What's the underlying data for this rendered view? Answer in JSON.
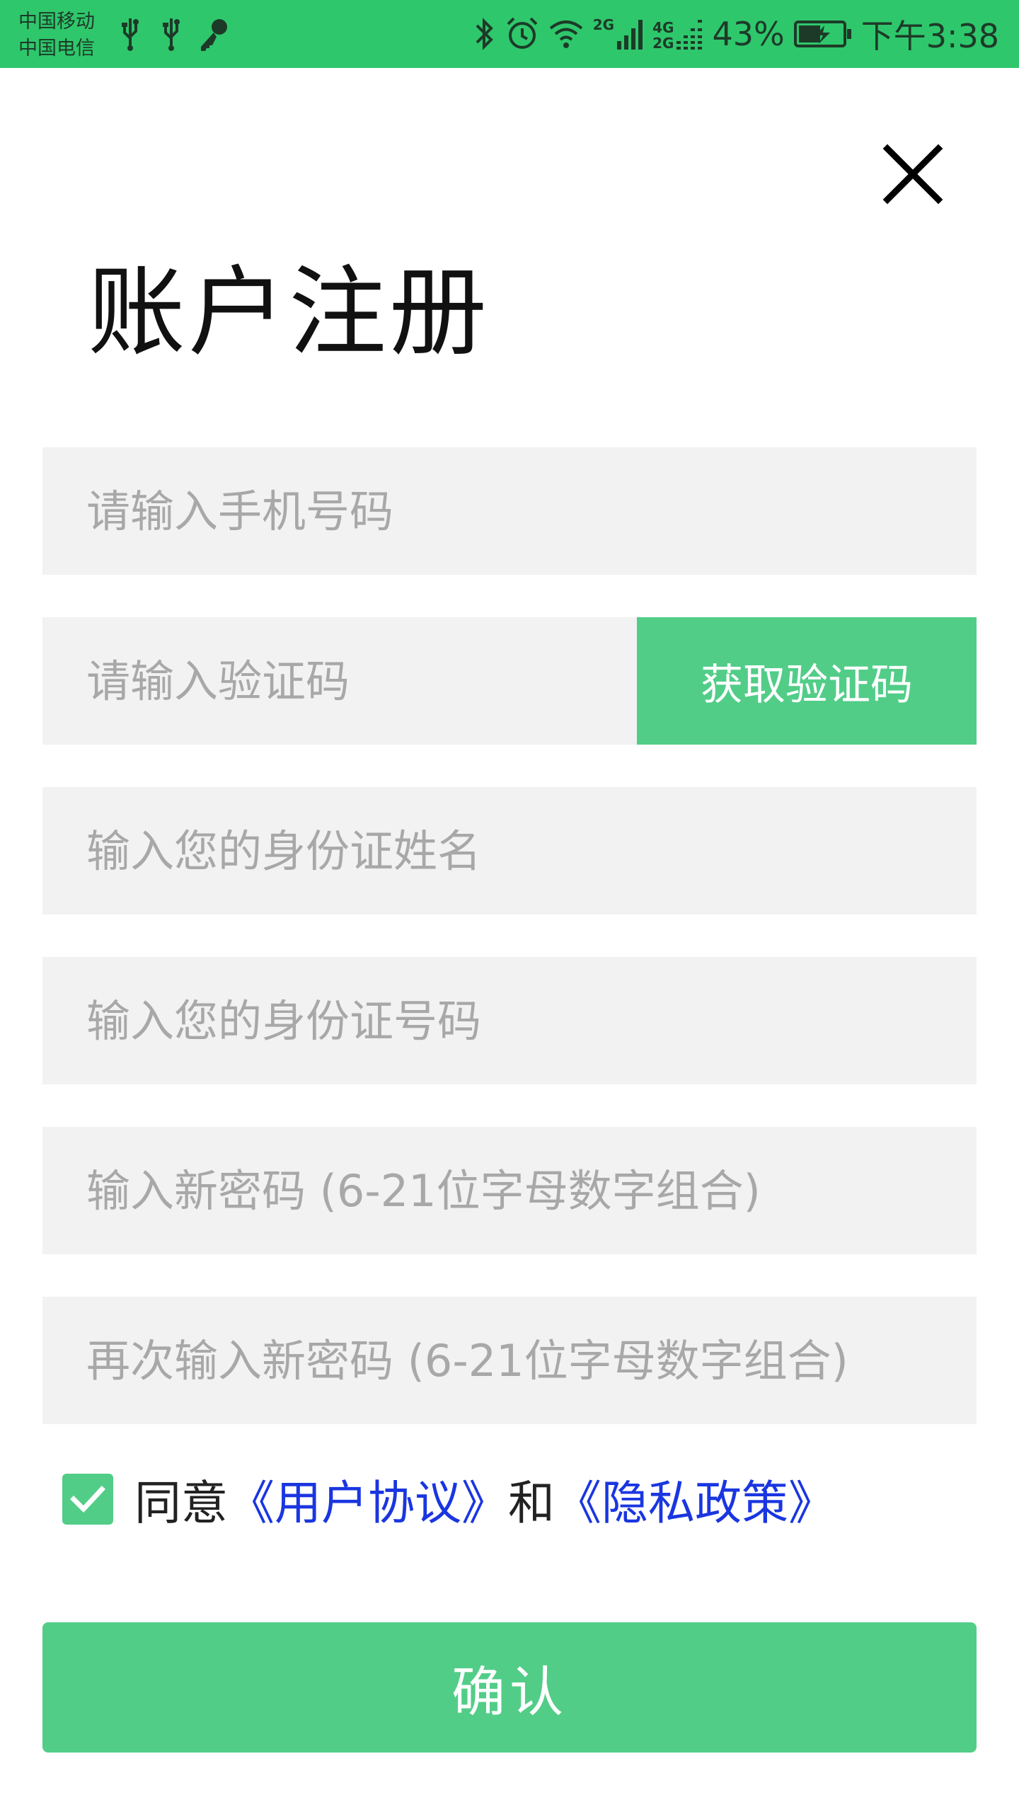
{
  "status_bar": {
    "carrier_1": "中国移动",
    "carrier_2": "中国电信",
    "signal_labels": [
      "2G",
      "4G",
      "2G"
    ],
    "battery": "43%",
    "time": "下午3:38",
    "icons": [
      "usb-icon",
      "usb-icon",
      "key-icon",
      "bluetooth-icon",
      "alarm-icon",
      "wifi-icon",
      "signal-icon",
      "signal-icon",
      "battery-charging-icon"
    ]
  },
  "header": {
    "title": "账户注册",
    "close_icon": "close-icon"
  },
  "form": {
    "phone_placeholder": "请输入手机号码",
    "code_placeholder": "请输入验证码",
    "get_code_label": "获取验证码",
    "name_placeholder": "输入您的身份证姓名",
    "id_placeholder": "输入您的身份证号码",
    "password_placeholder": "输入新密码 (6-21位字母数字组合)",
    "password_confirm_placeholder": "再次输入新密码 (6-21位字母数字组合)"
  },
  "agreement": {
    "checked": true,
    "prefix": "同意",
    "user_agreement": "《用户协议》",
    "conjunction": "和",
    "privacy_policy": "《隐私政策》"
  },
  "confirm_label": "确认",
  "colors": {
    "status_bar": "#2fc76c",
    "accent": "#52cd88",
    "link": "#1a36e0",
    "input_bg": "#f2f2f2",
    "placeholder": "#a8a8a8"
  }
}
